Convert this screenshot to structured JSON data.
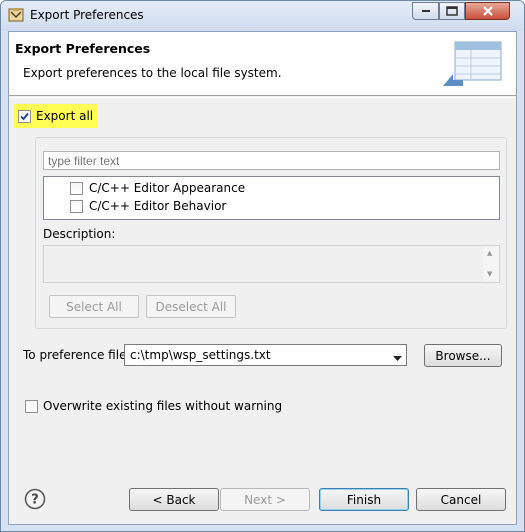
{
  "window": {
    "title": "Export Preferences"
  },
  "banner": {
    "title": "Export Preferences",
    "description": "Export preferences to the local file system."
  },
  "export_all": {
    "label": "Export all",
    "checked": true,
    "highlight_color": "#ffff55"
  },
  "filter": {
    "placeholder": "type filter text",
    "value": ""
  },
  "tree": {
    "items": [
      {
        "label": "C/C++ Editor Appearance",
        "checked": false
      },
      {
        "label": "C/C++ Editor Behavior",
        "checked": false
      }
    ]
  },
  "description": {
    "label": "Description:",
    "value": ""
  },
  "group_buttons": {
    "select_all": "Select All",
    "deselect_all": "Deselect All"
  },
  "preference_file": {
    "label": "To preference file:",
    "value": "c:\\tmp\\wsp_settings.txt",
    "browse_label": "Browse..."
  },
  "overwrite": {
    "label": "Overwrite existing files without warning",
    "checked": false
  },
  "footer": {
    "back_label": "< Back",
    "next_label": "Next >",
    "finish_label": "Finish",
    "cancel_label": "Cancel"
  },
  "icons": {
    "app": "eclipse-dialog-icon",
    "banner": "export-table-icon",
    "help": "help-icon"
  },
  "colors": {
    "accent": "#3c7fb1",
    "close_button": "#c7503b"
  }
}
